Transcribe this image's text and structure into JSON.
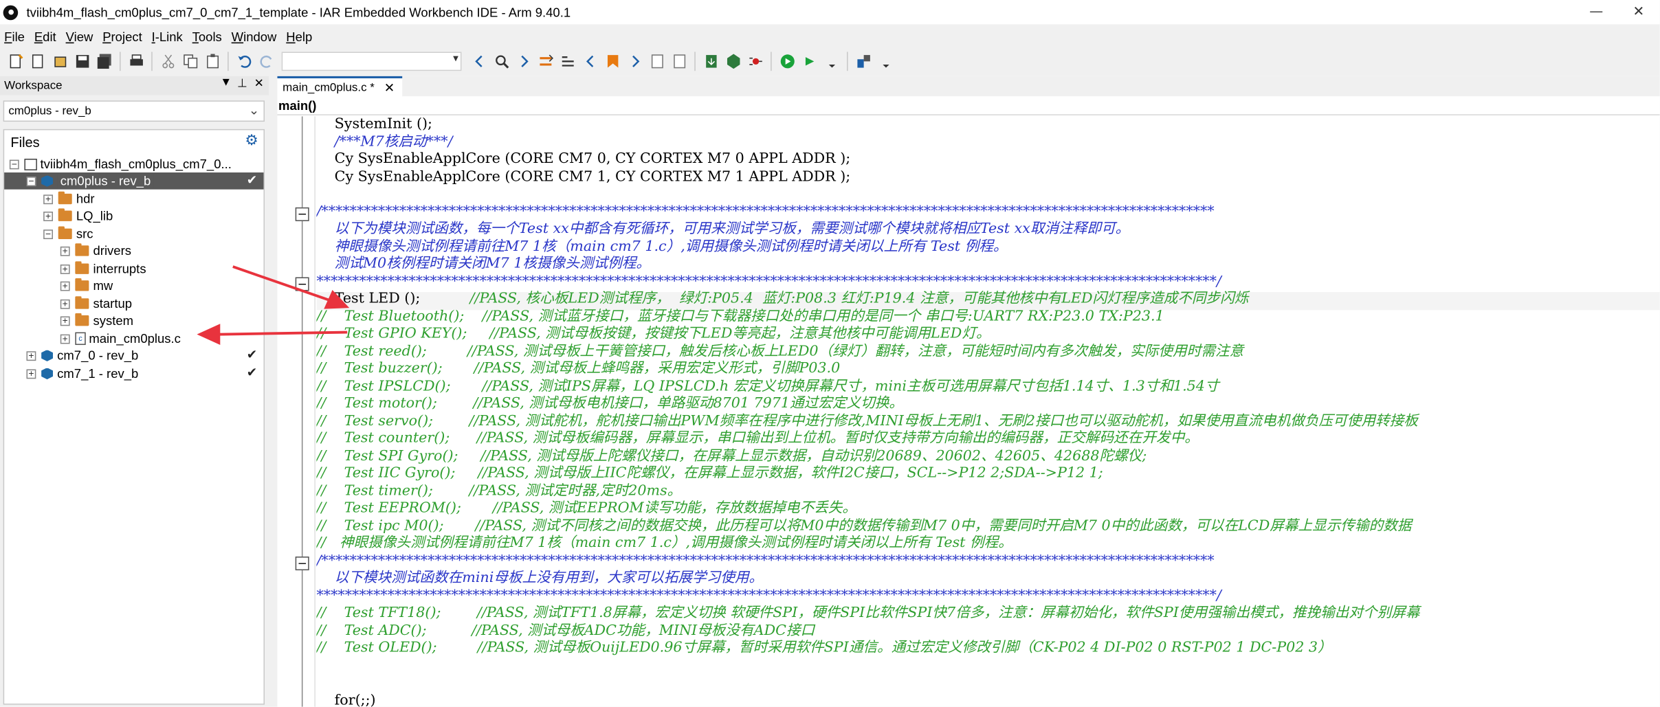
{
  "window": {
    "title": "tviibh4m_flash_cm0plus_cm7_0_cm7_1_template - IAR Embedded Workbench IDE - Arm 9.40.1",
    "minimize": "—",
    "close": "✕"
  },
  "menu": [
    {
      "label": "File",
      "u": "F",
      "rest": "ile"
    },
    {
      "label": "Edit",
      "u": "E",
      "rest": "dit"
    },
    {
      "label": "View",
      "u": "V",
      "rest": "iew"
    },
    {
      "label": "Project",
      "u": "P",
      "rest": "roject"
    },
    {
      "label": "I-Link",
      "u": "I",
      "rest": "-Link"
    },
    {
      "label": "Tools",
      "u": "T",
      "rest": "ools"
    },
    {
      "label": "Window",
      "u": "W",
      "rest": "indow"
    },
    {
      "label": "Help",
      "u": "H",
      "rest": "elp"
    }
  ],
  "workspace": {
    "title": "Workspace",
    "configuration": "cm0plus - rev_b",
    "files_header": "Files",
    "tree": {
      "root": "tviibh4m_flash_cm0plus_cm7_0...",
      "project_active": "cm0plus - rev_b",
      "folders": [
        "hdr",
        "LQ_lib",
        "src"
      ],
      "src_children": [
        "drivers",
        "interrupts",
        "mw",
        "startup",
        "system"
      ],
      "file": "main_cm0plus.c",
      "project2": "cm7_0 - rev_b",
      "project3": "cm7_1 - rev_b",
      "check": "✔"
    }
  },
  "editor": {
    "tab_label": "main_cm0plus.c *",
    "tab_close": "✕",
    "function_bar": "main()",
    "lines": [
      {
        "cls": "cn",
        "text": "    SystemInit ();"
      },
      {
        "cls": "cb",
        "text": "    /***M7核启动***/"
      },
      {
        "cls": "cn",
        "text": "    Cy SysEnableApplCore (CORE CM7 0, CY CORTEX M7 0 APPL ADDR );"
      },
      {
        "cls": "cn",
        "text": "    Cy SysEnableApplCore (CORE CM7 1, CY CORTEX M7 1 APPL ADDR );"
      },
      {
        "cls": "cn",
        "text": ""
      },
      {
        "cls": "cb",
        "text": "/******************************************************************************************************************************"
      },
      {
        "cls": "cb",
        "text": "    以下为模块测试函数，每一个Test xx中都含有死循环，可用来测试学习板，需要测试哪个模块就将相应Test xx取消注释即可。"
      },
      {
        "cls": "cb",
        "text": "    神眼摄像头测试例程请前往M7 1核（main cm7 1.c）,调用摄像头测试例程时请关闭以上所有 Test 例程。"
      },
      {
        "cls": "cb",
        "text": "    测试M0核例程时请关闭M7 1核摄像头测试例程。"
      },
      {
        "cls": "cb",
        "text": "*******************************************************************************************************************************/"
      },
      {
        "cls": "cn",
        "text": "    Test LED ();",
        "trail": "           //PASS, 核心板LED测试程序，  绿灯:P05.4  蓝灯:P08.3 红灯:P19.4 注意，可能其他核中有LED闪灯程序造成不同步闪烁"
      },
      {
        "cls": "cm",
        "text": "//    Test Bluetooth();    //PASS, 测试蓝牙接口，蓝牙接口与下载器接口处的串口用的是同一个 串口号:UART7 RX:P23.0 TX:P23.1"
      },
      {
        "cls": "cm",
        "text": "//    Test GPIO KEY();     //PASS, 测试母板按键，按键按下LED等亮起，注意其他核中可能调用LED灯。"
      },
      {
        "cls": "cm",
        "text": "//    Test reed();         //PASS, 测试母板上干簧管接口，触发后核心板上LED0（绿灯）翻转，注意，可能短时间内有多次触发，实际使用时需注意"
      },
      {
        "cls": "cm",
        "text": "//    Test buzzer();       //PASS, 测试母板上蜂鸣器，采用宏定义形式，引脚P03.0"
      },
      {
        "cls": "cm",
        "text": "//    Test IPSLCD();       //PASS, 测试IPS屏幕，LQ IPSLCD.h 宏定义切换屏幕尺寸，mini主板可选用屏幕尺寸包括1.14寸、1.3寸和1.54寸"
      },
      {
        "cls": "cm",
        "text": "//    Test motor();        //PASS, 测试母板电机接口，单路驱动8701 7971通过宏定义切换。"
      },
      {
        "cls": "cm",
        "text": "//    Test servo();        //PASS, 测试舵机，舵机接口输出PWM频率在程序中进行修改,MINI母板上无刷1、无刷2接口也可以驱动舵机，如果使用直流电机做负压可使用转接板"
      },
      {
        "cls": "cm",
        "text": "//    Test counter();      //PASS, 测试母板编码器，屏幕显示，串口输出到上位机。暂时仅支持带方向输出的编码器，正交解码还在开发中。"
      },
      {
        "cls": "cm",
        "text": "//    Test SPI Gyro();     //PASS, 测试母版上陀螺仪接口，在屏幕上显示数据，自动识别20689、20602、42605、42688陀螺仪;"
      },
      {
        "cls": "cm",
        "text": "//    Test IIC Gyro();     //PASS, 测试母版上IIC陀螺仪，在屏幕上显示数据，软件I2C接口，SCL-->P12 2;SDA-->P12 1;"
      },
      {
        "cls": "cm",
        "text": "//    Test timer();        //PASS, 测试定时器,定时20ms。"
      },
      {
        "cls": "cm",
        "text": "//    Test EEPROM();       //PASS, 测试EEPROM读写功能，存放数据掉电不丢失。"
      },
      {
        "cls": "cm",
        "text": "//    Test ipc M0();       //PASS, 测试不同核之间的数据交换，此历程可以将M0中的数据传输到M7 0中，需要同时开启M7 0中的此函数，可以在LCD屏幕上显示传输的数据"
      },
      {
        "cls": "cm",
        "text": "//   神眼摄像头测试例程请前往M7 1核（main cm7 1.c）,调用摄像头测试例程时请关闭以上所有 Test 例程。"
      },
      {
        "cls": "cb",
        "text": "/******************************************************************************************************************************"
      },
      {
        "cls": "cb",
        "text": "    以下模块测试函数在mini母板上没有用到，大家可以拓展学习使用。"
      },
      {
        "cls": "cb",
        "text": "*******************************************************************************************************************************/"
      },
      {
        "cls": "cm",
        "text": "//    Test TFT18();        //PASS, 测试TFT1.8屏幕，宏定义切换 软硬件SPI，硬件SPI比软件SPI快7倍多，注意：屏幕初始化，软件SPI使用强输出模式，推挽输出对个别屏幕"
      },
      {
        "cls": "cm",
        "text": "//    Test ADC();          //PASS, 测试母板ADC功能，MINI母板没有ADC接口"
      },
      {
        "cls": "cm",
        "text": "//    Test OLED();         //PASS, 测试母板OuijLED0.96寸屏幕，暂时采用软件SPI通信。通过宏定义修改引脚（CK-P02 4 DI-P02 0 RST-P02 1 DC-P02 3）"
      },
      {
        "cls": "cn",
        "text": ""
      },
      {
        "cls": "cn",
        "text": ""
      },
      {
        "cls": "cn",
        "text": "    for(;;)"
      }
    ]
  },
  "colors": {
    "comment": "#2f9f2f",
    "block_comment": "#2a36c8",
    "selection": "#595959",
    "arrow": "#e8333d",
    "accent": "#1c5fa8"
  }
}
